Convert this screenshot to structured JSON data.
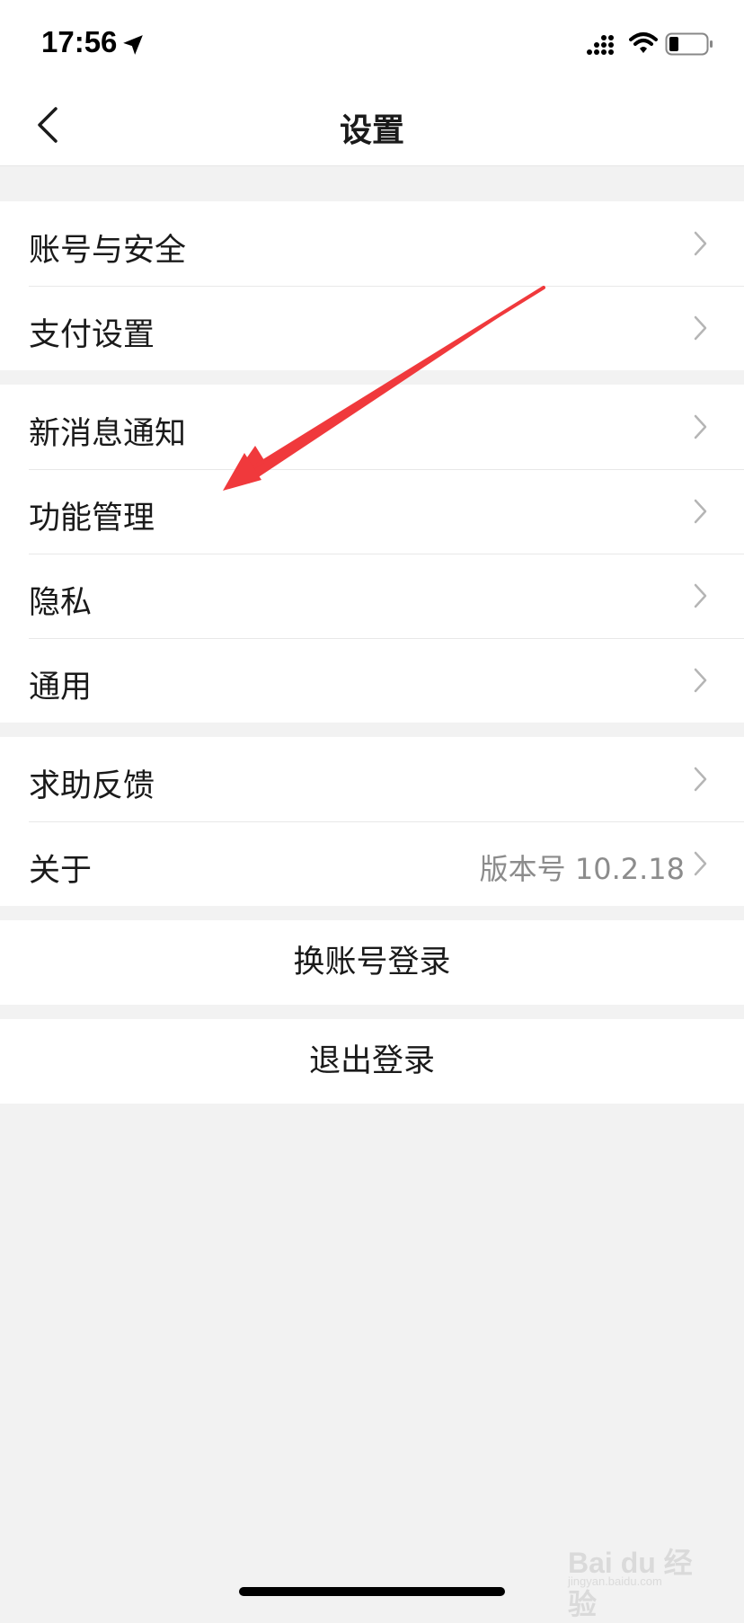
{
  "status_bar": {
    "time": "17:56",
    "icons": [
      "location-arrow-icon",
      "signal-icon",
      "wifi-icon",
      "battery-icon"
    ]
  },
  "nav": {
    "title": "设置",
    "back_icon": "chevron-left-icon"
  },
  "groups": [
    {
      "items": [
        {
          "label": "账号与安全"
        },
        {
          "label": "支付设置"
        }
      ]
    },
    {
      "items": [
        {
          "label": "新消息通知"
        },
        {
          "label": "功能管理"
        },
        {
          "label": "隐私"
        },
        {
          "label": "通用"
        }
      ]
    },
    {
      "items": [
        {
          "label": "求助反馈"
        },
        {
          "label": "关于",
          "value": "版本号 10.2.18"
        }
      ]
    }
  ],
  "actions": {
    "switch_account": "换账号登录",
    "logout": "退出登录"
  },
  "annotation": {
    "color": "#f0393c",
    "icon": "red-arrow-annotation"
  },
  "watermark": {
    "brand": "Bai du 经验",
    "url": "jingyan.baidu.com"
  },
  "colors": {
    "background": "#f2f2f2",
    "surface": "#ffffff",
    "secondary_text": "#8c8c8c"
  }
}
